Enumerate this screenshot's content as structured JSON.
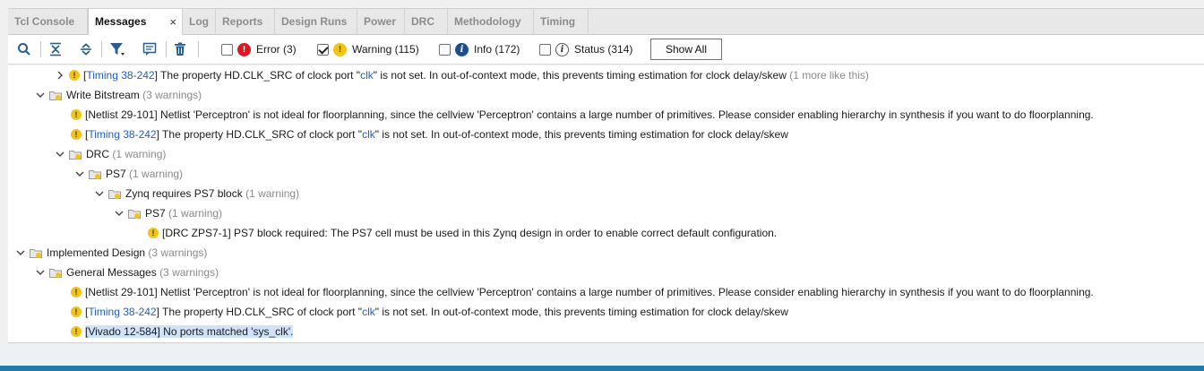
{
  "tabs": [
    {
      "label": "Tcl Console",
      "active": false
    },
    {
      "label": "Messages",
      "active": true
    },
    {
      "label": "Log",
      "active": false
    },
    {
      "label": "Reports",
      "active": false
    },
    {
      "label": "Design Runs",
      "active": false
    },
    {
      "label": "Power",
      "active": false
    },
    {
      "label": "DRC",
      "active": false
    },
    {
      "label": "Methodology",
      "active": false
    },
    {
      "label": "Timing",
      "active": false
    }
  ],
  "tab_close_glyph": "×",
  "toolbar": {
    "icons": [
      "search-icon",
      "collapse-all-icon",
      "expand-all-icon",
      "filter-icon",
      "message-icon",
      "delete-icon"
    ],
    "filters": {
      "error": {
        "label": "Error (3)",
        "checked": false
      },
      "warning": {
        "label": "Warning (115)",
        "checked": true
      },
      "info": {
        "label": "Info (172)",
        "checked": false
      },
      "status": {
        "label": "Status (314)",
        "checked": false
      }
    },
    "show_all": "Show All"
  },
  "tree": {
    "r0": {
      "link": "Timing 38-242",
      "text": "] The property HD.CLK_SRC of clock port \"",
      "port": "clk",
      "text2": "\" is not set. In out-of-context mode, this prevents timing estimation for clock delay/skew",
      "more": "(1 more like this)"
    },
    "r1": {
      "label": "Write Bitstream",
      "count": "(3 warnings)"
    },
    "r2": {
      "text": "[Netlist 29-101] Netlist 'Perceptron' is not ideal for floorplanning, since the cellview 'Perceptron' contains a large number of primitives. Please consider enabling hierarchy in synthesis if you want to do floorplanning."
    },
    "r3": {
      "link": "Timing 38-242",
      "text": "] The property HD.CLK_SRC of clock port \"",
      "port": "clk",
      "text2": "\" is not set. In out-of-context mode, this prevents timing estimation for clock delay/skew"
    },
    "r4": {
      "label": "DRC",
      "count": "(1 warning)"
    },
    "r5": {
      "label": "PS7",
      "count": "(1 warning)"
    },
    "r6": {
      "label": "Zynq requires PS7 block",
      "count": "(1 warning)"
    },
    "r7": {
      "label": "PS7",
      "count": "(1 warning)"
    },
    "r8": {
      "text": "[DRC ZPS7-1] PS7 block required: The PS7 cell must be used in this Zynq design in order to enable correct default configuration."
    },
    "r9": {
      "label": "Implemented Design",
      "count": "(3 warnings)"
    },
    "r10": {
      "label": "General Messages",
      "count": "(3 warnings)"
    },
    "r11": {
      "text": "[Netlist 29-101] Netlist 'Perceptron' is not ideal for floorplanning, since the cellview 'Perceptron' contains a large number of primitives. Please consider enabling hierarchy in synthesis if you want to do floorplanning."
    },
    "r12": {
      "link": "Timing 38-242",
      "text": "] The property HD.CLK_SRC of clock port \"",
      "port": "clk",
      "text2": "\" is not set. In out-of-context mode, this prevents timing estimation for clock delay/skew"
    },
    "r13": {
      "text": "[Vivado 12-584] No ports matched 'sys_clk'."
    }
  },
  "colors": {
    "link": "#1f5fbf",
    "warning": "#f2c418",
    "error": "#d9181f",
    "info": "#1f4e8c",
    "selection": "#cfe2f7",
    "statusbar": "#1e7bb0"
  }
}
